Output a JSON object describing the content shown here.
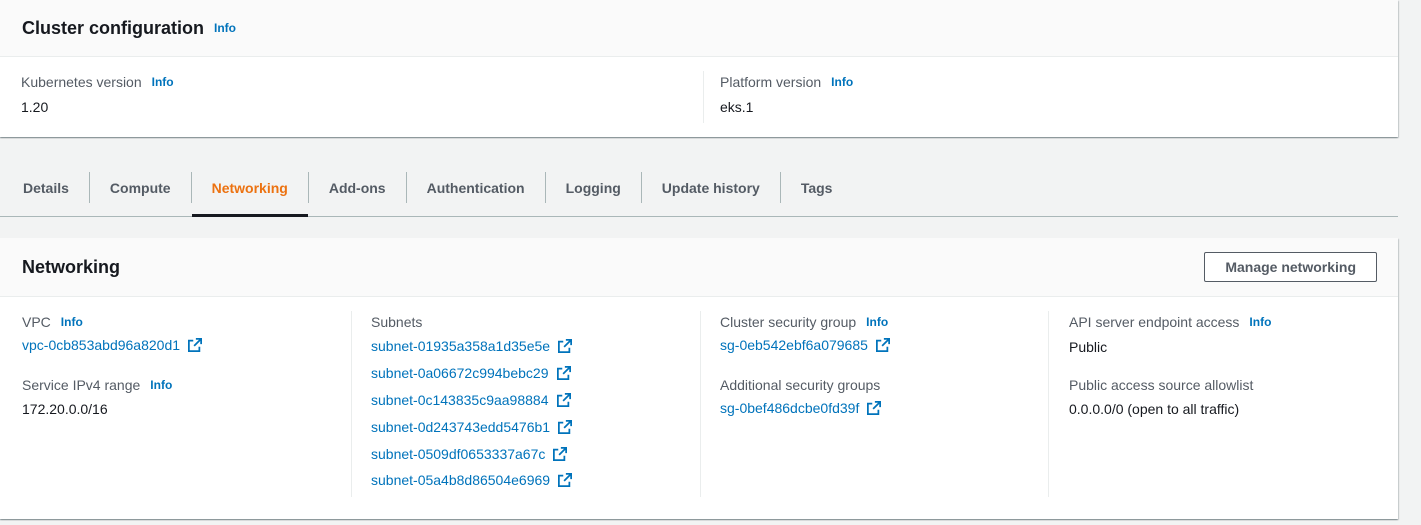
{
  "cluster_config": {
    "title": "Cluster configuration",
    "info": "Info",
    "kubernetes_version_label": "Kubernetes version",
    "kubernetes_version": "1.20",
    "platform_version_label": "Platform version",
    "platform_version": "eks.1"
  },
  "tabs": [
    {
      "label": "Details",
      "active": false
    },
    {
      "label": "Compute",
      "active": false
    },
    {
      "label": "Networking",
      "active": true
    },
    {
      "label": "Add-ons",
      "active": false
    },
    {
      "label": "Authentication",
      "active": false
    },
    {
      "label": "Logging",
      "active": false
    },
    {
      "label": "Update history",
      "active": false
    },
    {
      "label": "Tags",
      "active": false
    }
  ],
  "networking": {
    "title": "Networking",
    "manage_button": "Manage networking",
    "info": "Info",
    "vpc_label": "VPC",
    "vpc_id": "vpc-0cb853abd96a820d1",
    "service_ipv4_label": "Service IPv4 range",
    "service_ipv4_value": "172.20.0.0/16",
    "subnets_label": "Subnets",
    "subnets": [
      "subnet-01935a358a1d35e5e",
      "subnet-0a06672c994bebc29",
      "subnet-0c143835c9aa98884",
      "subnet-0d243743edd5476b1",
      "subnet-0509df0653337a67c",
      "subnet-05a4b8d86504e6969"
    ],
    "cluster_sg_label": "Cluster security group",
    "cluster_sg": "sg-0eb542ebf6a079685",
    "additional_sg_label": "Additional security groups",
    "additional_sg": "sg-0bef486dcbe0fd39f",
    "api_endpoint_label": "API server endpoint access",
    "api_endpoint_value": "Public",
    "allowlist_label": "Public access source allowlist",
    "allowlist_value": "0.0.0.0/0 (open to all traffic)"
  },
  "colors": {
    "link": "#0073bb",
    "active_tab": "#ec7211",
    "background": "#f2f3f3"
  },
  "icons": {
    "external_link": "external-link-icon"
  }
}
